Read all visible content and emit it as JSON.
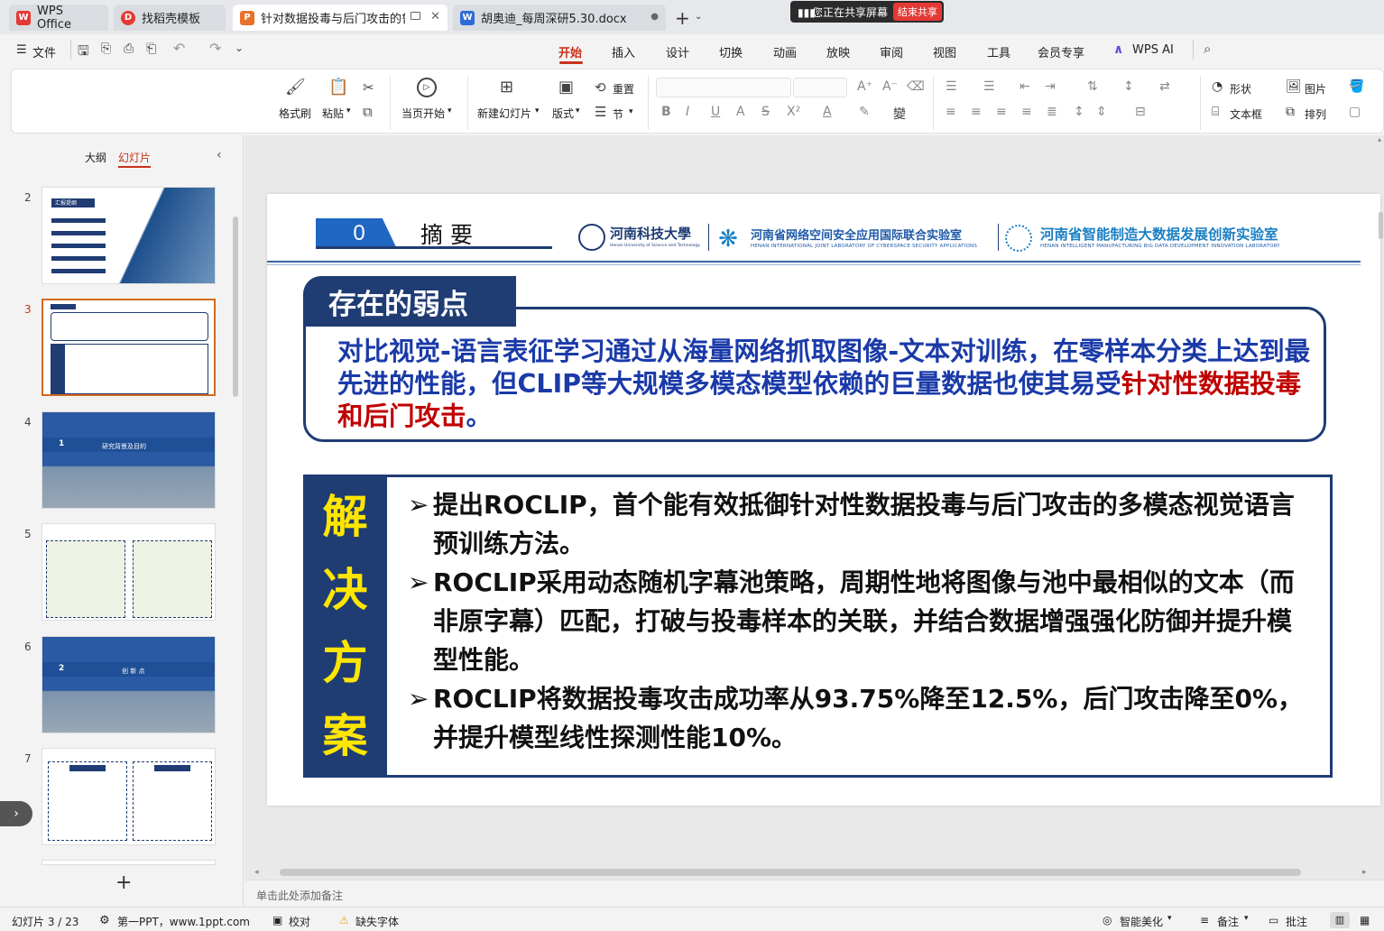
{
  "tabs": [
    {
      "label": "WPS Office",
      "icon": "W",
      "color": "#e53935"
    },
    {
      "label": "找稻壳模板",
      "icon": "D",
      "color": "#e53935"
    },
    {
      "label": "针对数据投毒与后门攻击的鲁",
      "icon": "P",
      "color": "#e8712b"
    },
    {
      "label": "胡奥迪_每周深研5.30.docx",
      "icon": "W",
      "color": "#2f6bd8"
    }
  ],
  "share": {
    "text": "您正在共享屏幕",
    "end": "结束共享"
  },
  "menubar": {
    "file": "文件",
    "tabs": [
      "开始",
      "插入",
      "设计",
      "切换",
      "动画",
      "放映",
      "审阅",
      "视图",
      "工具",
      "会员专享",
      "WPS AI"
    ]
  },
  "ribbon": {
    "format_painter": "格式刷",
    "paste": "粘贴",
    "from_current": "当页开始",
    "new_slide": "新建幻灯片",
    "layout": "版式",
    "section": "节",
    "reset": "重置",
    "shape": "形状",
    "picture": "图片",
    "textbox": "文本框",
    "arrange": "排列"
  },
  "panel": {
    "outline": "大纲",
    "slides": "幻灯片",
    "numbers": [
      "2",
      "3",
      "4",
      "5",
      "6",
      "7"
    ],
    "thumb4_title": "研究背景及目的",
    "thumb4_num": "1",
    "thumb6_title": "创 新 点",
    "thumb6_num": "2",
    "thumb2_title": "汇报提纲"
  },
  "slide": {
    "section_num": "0",
    "section_title": "摘  要",
    "logo1_cn": "河南科技大學",
    "logo1_en": "Henan University of Science and Technology",
    "logo2_cn": "河南省网络空间安全应用国际联合实验室",
    "logo2_en": "HENAN INTERNATIONAL JOINT LABORATORY OF CYBERSPACE SECURITY APPLICATIONS",
    "logo3_cn": "河南省智能制造大数据发展创新实验室",
    "logo3_en": "HENAN INTELLIGENT MANUFACTURING BIG DATA DEVELOPMENT INNOVATION LABORATORY",
    "weakness_title": "存在的弱点",
    "weakness_text_blue": "对比视觉-语言表征学习通过从海量网络抓取图像-文本对训练，在零样本分类上达到最先进的性能，但CLIP等大规模多模态模型依赖的巨量数据也使其易受",
    "weakness_text_red": "针对性数据投毒和后门攻击",
    "weakness_text_end": "。",
    "solution_label": [
      "解",
      "决",
      "方",
      "案"
    ],
    "bullets": [
      "提出ROCLIP，首个能有效抵御针对性数据投毒与后门攻击的多模态视觉语言预训练方法。",
      "ROCLIP采用动态随机字幕池策略，周期性地将图像与池中最相似的文本（而非原字幕）匹配，打破与投毒样本的关联，并结合数据增强强化防御并提升模型性能。",
      "ROCLIP将数据投毒攻击成功率从93.75%降至12.5%，后门攻击降至0%，并提升模型线性探测性能10%。"
    ]
  },
  "notes_placeholder": "单击此处添加备注",
  "status": {
    "slide_count": "幻灯片 3 / 23",
    "theme": "第一PPT，www.1ppt.com",
    "proof": "校对",
    "missing_font": "缺失字体",
    "beautify": "智能美化",
    "notes": "备注",
    "comments": "批注"
  },
  "colors": {
    "accent": "#c8321a",
    "slide_navy": "#1f3c73",
    "slide_blue": "#1a3aa8",
    "slide_red": "#c00000",
    "solution_yellow": "#ffe600"
  }
}
